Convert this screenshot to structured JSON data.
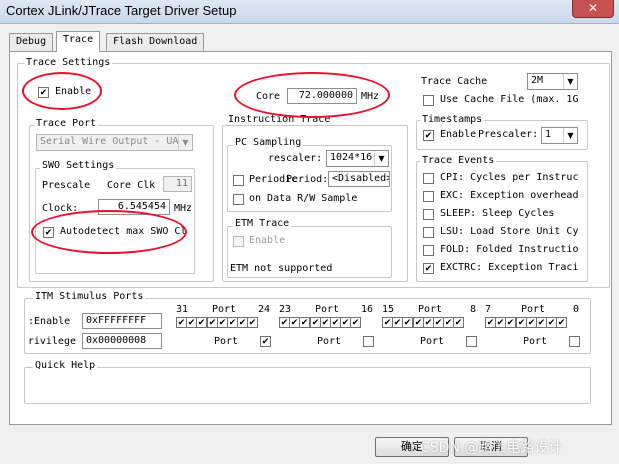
{
  "window": {
    "title": "Cortex JLink/JTrace Target Driver Setup",
    "close_glyph": "✕"
  },
  "tabs": [
    {
      "label": "Debug"
    },
    {
      "label": "Trace"
    },
    {
      "label": "Flash Download"
    }
  ],
  "trace_settings": {
    "group_label": "Trace Settings",
    "enable_label": "Enable",
    "enable_checked": true,
    "core_label": "Core",
    "core_value": "72.000000",
    "core_unit": "MHz"
  },
  "trace_port": {
    "group_label": "Trace Port",
    "port_value": "Serial Wire Output - UA",
    "swo": {
      "group_label": "SWO Settings",
      "prescale_label": "Prescale",
      "core_clk_label": "Core Clk",
      "prescale_value": "11",
      "clock_label": "Clock:",
      "clock_value": "6.545454",
      "clock_unit": "MHz",
      "autodetect_label": "Autodetect max SWO Cl",
      "autodetect_checked": true
    }
  },
  "instruction_trace": {
    "group_label": "Instruction Trace",
    "pc_sampling": {
      "group_label": "PC Sampling",
      "rescaler_label": "rescaler:",
      "rescaler_value": "1024*16",
      "periodic_label": "Periodic",
      "period_label": "Period:",
      "period_value": "<Disabled>",
      "on_data_label": "on Data R/W Sample"
    },
    "etm": {
      "group_label": "ETM Trace",
      "enable_label": "Enable",
      "status": "ETM not supported"
    }
  },
  "trace_cache": {
    "label": "Trace Cache",
    "value": "2M",
    "use_cache_label": "Use Cache File  (max. 1G"
  },
  "timestamps": {
    "group_label": "Timestamps",
    "enable_label": "Enable",
    "prescaler_label": "Prescaler:",
    "prescaler_value": "1"
  },
  "trace_events": {
    "group_label": "Trace Events",
    "items": [
      {
        "label": "CPI: Cycles per Instruc",
        "checked": false
      },
      {
        "label": "EXC: Exception overhead",
        "checked": false
      },
      {
        "label": "SLEEP: Sleep Cycles",
        "checked": false
      },
      {
        "label": "LSU: Load Store Unit Cy",
        "checked": false
      },
      {
        "label": "FOLD: Folded Instructio",
        "checked": false
      },
      {
        "label": "EXCTRC: Exception Traci",
        "checked": true
      }
    ]
  },
  "itm": {
    "group_label": "ITM Stimulus Ports",
    "enable_label": "Enable:",
    "enable_value": "0xFFFFFFFF",
    "privilege_label": "Privilege:",
    "privilege_value": "0x00000008",
    "port_groups": [
      {
        "hi": "31",
        "port_label": "Port",
        "lo": "24",
        "priv_checked": true
      },
      {
        "hi": "23",
        "port_label": "Port",
        "lo": "16",
        "priv_checked": false
      },
      {
        "hi": "15",
        "port_label": "Port",
        "lo": "8",
        "priv_checked": false
      },
      {
        "hi": "7",
        "port_label": "Port",
        "lo": "0",
        "priv_checked": false
      }
    ],
    "enabled_port_count": 32
  },
  "quick_help": {
    "label": "Quick Help"
  },
  "buttons": {
    "ok_label": "确定",
    "cancel_label": "取消"
  },
  "watermark": {
    "text": "CSDN @路上电路设计"
  },
  "colors": {
    "annotation_red": "#e8102a",
    "panel_bg": "#ffffff",
    "dialog_bg": "#f0f0f0"
  }
}
